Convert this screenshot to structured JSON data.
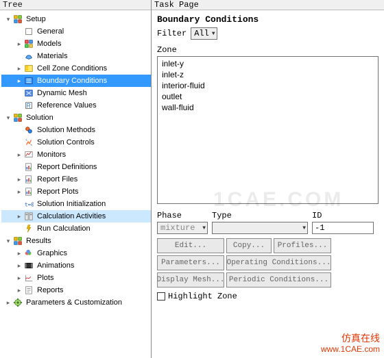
{
  "tree_title": "Tree",
  "task_title": "Task Page",
  "tree": [
    {
      "indent": 0,
      "exp": "▾",
      "icon": "setup",
      "label": "Setup",
      "sel": false
    },
    {
      "indent": 1,
      "exp": "",
      "icon": "general",
      "label": "General",
      "sel": false
    },
    {
      "indent": 1,
      "exp": "▸",
      "icon": "models",
      "label": "Models",
      "sel": false
    },
    {
      "indent": 1,
      "exp": "",
      "icon": "materials",
      "label": "Materials",
      "sel": false
    },
    {
      "indent": 1,
      "exp": "▸",
      "icon": "cellzone",
      "label": "Cell Zone Conditions",
      "sel": false
    },
    {
      "indent": 1,
      "exp": "▸",
      "icon": "boundary",
      "label": "Boundary Conditions",
      "sel": true
    },
    {
      "indent": 1,
      "exp": "",
      "icon": "dynmesh",
      "label": "Dynamic Mesh",
      "sel": false
    },
    {
      "indent": 1,
      "exp": "",
      "icon": "refvals",
      "label": "Reference Values",
      "sel": false
    },
    {
      "indent": 0,
      "exp": "▾",
      "icon": "solution",
      "label": "Solution",
      "sel": false
    },
    {
      "indent": 1,
      "exp": "",
      "icon": "solmeth",
      "label": "Solution Methods",
      "sel": false
    },
    {
      "indent": 1,
      "exp": "",
      "icon": "solctrl",
      "label": "Solution Controls",
      "sel": false
    },
    {
      "indent": 1,
      "exp": "▸",
      "icon": "monitors",
      "label": "Monitors",
      "sel": false
    },
    {
      "indent": 1,
      "exp": "",
      "icon": "repdef",
      "label": "Report Definitions",
      "sel": false
    },
    {
      "indent": 1,
      "exp": "▸",
      "icon": "repfiles",
      "label": "Report Files",
      "sel": false
    },
    {
      "indent": 1,
      "exp": "▸",
      "icon": "repplots",
      "label": "Report Plots",
      "sel": false
    },
    {
      "indent": 1,
      "exp": "",
      "icon": "solinit",
      "label": "Solution Initialization",
      "sel": false
    },
    {
      "indent": 1,
      "exp": "▸",
      "icon": "calcs",
      "label": "Calculation Activities",
      "sel": false,
      "hovered": true
    },
    {
      "indent": 1,
      "exp": "",
      "icon": "runcalc",
      "label": "Run Calculation",
      "sel": false
    },
    {
      "indent": 0,
      "exp": "▾",
      "icon": "results",
      "label": "Results",
      "sel": false
    },
    {
      "indent": 1,
      "exp": "▸",
      "icon": "graphics",
      "label": "Graphics",
      "sel": false
    },
    {
      "indent": 1,
      "exp": "▸",
      "icon": "anim",
      "label": "Animations",
      "sel": false
    },
    {
      "indent": 1,
      "exp": "▸",
      "icon": "plots",
      "label": "Plots",
      "sel": false
    },
    {
      "indent": 1,
      "exp": "▸",
      "icon": "reports",
      "label": "Reports",
      "sel": false
    },
    {
      "indent": 0,
      "exp": "▸",
      "icon": "params",
      "label": "Parameters & Customization",
      "sel": false
    }
  ],
  "section_title": "Boundary Conditions",
  "filter_label": "Filter",
  "filter_value": "All",
  "zone_label": "Zone",
  "zones": [
    "inlet-y",
    "inlet-z",
    "interior-fluid",
    "outlet",
    "wall-fluid"
  ],
  "phase_label": "Phase",
  "phase_value": "mixture",
  "type_label": "Type",
  "type_value": "",
  "id_label": "ID",
  "id_value": "-1",
  "buttons": {
    "edit": "Edit...",
    "copy": "Copy...",
    "profiles": "Profiles...",
    "parameters": "Parameters...",
    "operating": "Operating Conditions...",
    "displaymesh": "Display Mesh...",
    "periodic": "Periodic Conditions..."
  },
  "highlight_label": "Highlight Zone",
  "highlight_checked": false,
  "watermark": "1CAE.COM",
  "footer": {
    "line1": "仿真在线",
    "line2": "www.1CAE.com"
  }
}
